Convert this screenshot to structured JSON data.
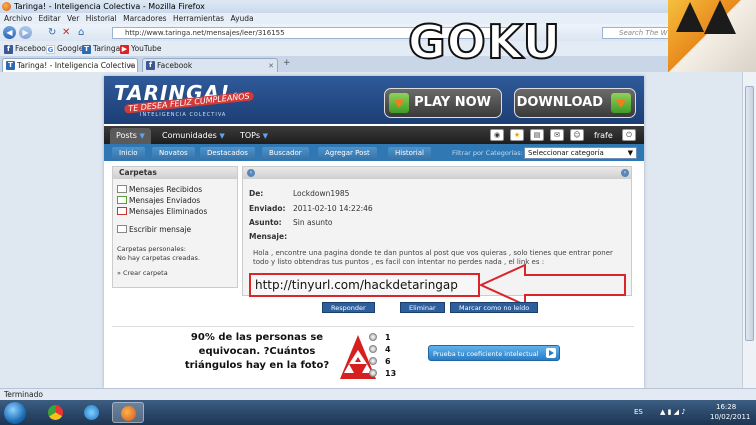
{
  "window": {
    "title": "Taringa! - Inteligencia Colectiva - Mozilla Firefox"
  },
  "menu": [
    "Archivo",
    "Editar",
    "Ver",
    "Historial",
    "Marcadores",
    "Herramientas",
    "Ayuda"
  ],
  "url": "http://www.taringa.net/mensajes/leer/316155",
  "search": {
    "placeholder": "Search The Web"
  },
  "bookmarks": [
    "Facebook",
    "Google",
    "Taringa!",
    "YouTube"
  ],
  "tabs": [
    {
      "label": "Taringa! - Inteligencia Colectiva",
      "active": true
    },
    {
      "label": "Facebook",
      "active": false
    }
  ],
  "header_art": {
    "text": "GOKU"
  },
  "site": {
    "logo": "TARINGA!",
    "logo_banner": "TE DESEA FELIZ CUMPLEAÑOS",
    "logo_tagline": "INTELIGENCIA COLECTIVA",
    "play_now": "PLAY NOW",
    "download": "DOWNLOAD",
    "topnav": [
      "Posts",
      "Comunidades",
      "TOPs"
    ],
    "user": "frafe",
    "subnav": [
      "Inicio",
      "Novatos",
      "Destacados",
      "Buscador",
      "Agregar Post",
      "Historial"
    ],
    "filter_label": "Filtrar por Categorías:",
    "filter_value": "Seleccionar categoría"
  },
  "sidebar": {
    "title": "Carpetas",
    "items": [
      "Mensajes Recibidos",
      "Mensajes Enviados",
      "Mensajes Eliminados"
    ],
    "compose": "Escribir mensaje",
    "personal_label": "Carpetas personales:",
    "personal_empty": "No hay carpetas creadas.",
    "create": "» Crear carpeta"
  },
  "message": {
    "from_label": "De:",
    "from": "Lockdown1985",
    "sent_label": "Enviado:",
    "sent": "2011-02-10 14:22:46",
    "subject_label": "Asunto:",
    "subject": "Sin asunto",
    "body_label": "Mensaje:",
    "body": "Hola , encontre una pagina donde te dan puntos al post que vos quieras , solo tienes que entrar poner todo y listo obtendras tus puntos , es facil con intentar no perdes nada , el link es :",
    "link": "http://tinyurl.com/hackdetaringap"
  },
  "actions": [
    "Responder",
    "Eliminar",
    "Marcar como no leído"
  ],
  "ad": {
    "headline": "90% de las personas se equivocan. ?Cuántos triángulos hay en la foto?",
    "options": [
      "1",
      "4",
      "6",
      "13"
    ],
    "button": "Prueba tu coeficiente intelectual"
  },
  "status": "Terminado",
  "tray": {
    "lang": "ES",
    "time": "16:28",
    "date": "10/02/2011"
  }
}
